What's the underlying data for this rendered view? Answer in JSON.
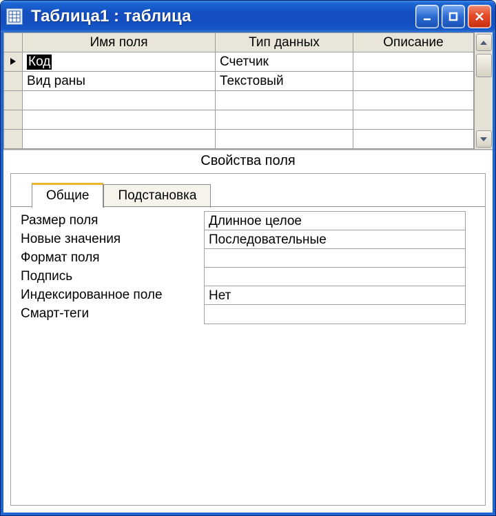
{
  "window": {
    "title": "Таблица1 : таблица"
  },
  "design": {
    "columns": {
      "field_name": "Имя поля",
      "data_type": "Тип данных",
      "description": "Описание"
    },
    "rows": [
      {
        "selected": true,
        "field_name": "Код",
        "data_type": "Счетчик",
        "description": ""
      },
      {
        "selected": false,
        "field_name": "Вид раны",
        "data_type": "Текстовый",
        "description": ""
      },
      {
        "selected": false,
        "field_name": "",
        "data_type": "",
        "description": ""
      },
      {
        "selected": false,
        "field_name": "",
        "data_type": "",
        "description": ""
      },
      {
        "selected": false,
        "field_name": "",
        "data_type": "",
        "description": ""
      }
    ]
  },
  "section_label": "Свойства поля",
  "tabs": {
    "general": "Общие",
    "lookup": "Подстановка"
  },
  "properties": [
    {
      "label": "Размер поля",
      "value": "Длинное целое"
    },
    {
      "label": "Новые значения",
      "value": "Последовательные"
    },
    {
      "label": "Формат поля",
      "value": ""
    },
    {
      "label": "Подпись",
      "value": ""
    },
    {
      "label": "Индексированное поле",
      "value": "Нет"
    },
    {
      "label": "Смарт-теги",
      "value": ""
    }
  ]
}
